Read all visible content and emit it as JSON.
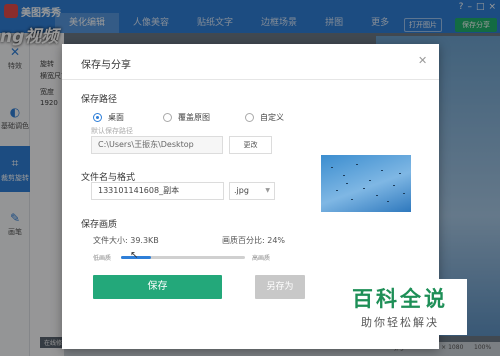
{
  "app": {
    "name": "美图秀秀",
    "tabs": [
      {
        "label": "美化编辑"
      },
      {
        "label": "人像美容"
      },
      {
        "label": "贴纸文字"
      },
      {
        "label": "边框场景"
      },
      {
        "label": "拼图"
      },
      {
        "label": "更多"
      }
    ],
    "open_label": "打开图片",
    "save_share_label": "保存分享",
    "window_controls": [
      "?",
      "–",
      "□",
      "×"
    ],
    "left_tools": [
      {
        "label": "特效",
        "icon": "magic-wand-icon"
      },
      {
        "label": "基础调色",
        "icon": "palette-icon"
      },
      {
        "label": "裁剪旋转",
        "icon": "crop-icon"
      },
      {
        "label": "画笔",
        "icon": "brush-icon"
      }
    ],
    "panel_labels": [
      "旋转",
      "横宽尺寸",
      "宽度",
      "1920"
    ],
    "watermark": "ng视频",
    "bottom_link": "在线修图教程",
    "status_left": "111...008.jpg",
    "status_right": "1920 × 1080",
    "zoom": "100%"
  },
  "dialog": {
    "title": "保存与分享",
    "save_path": {
      "heading": "保存路径",
      "options": [
        {
          "label": "桌面",
          "checked": true
        },
        {
          "label": "覆盖原图",
          "checked": false
        },
        {
          "label": "自定义",
          "checked": false
        }
      ],
      "hint": "默认保存路径",
      "path_value": "C:\\Users\\王振东\\Desktop",
      "change_label": "更改"
    },
    "file": {
      "heading": "文件名与格式",
      "name_value": "133101141608_副本",
      "format_value": ".jpg"
    },
    "quality": {
      "heading": "保存画质",
      "size_label": "文件大小: 39.3KB",
      "percent_label": "画质百分比: 24%",
      "low_label": "低画质",
      "high_label": "高画质",
      "level": 0.24
    },
    "save_label": "保存",
    "save_as_label": "另存为"
  },
  "badge": {
    "main": "百科全说",
    "sub": "助你轻松解决"
  },
  "colors": {
    "accent": "#2f7fd8",
    "save_button": "#23a87a",
    "badge_green": "#1e8f57"
  }
}
